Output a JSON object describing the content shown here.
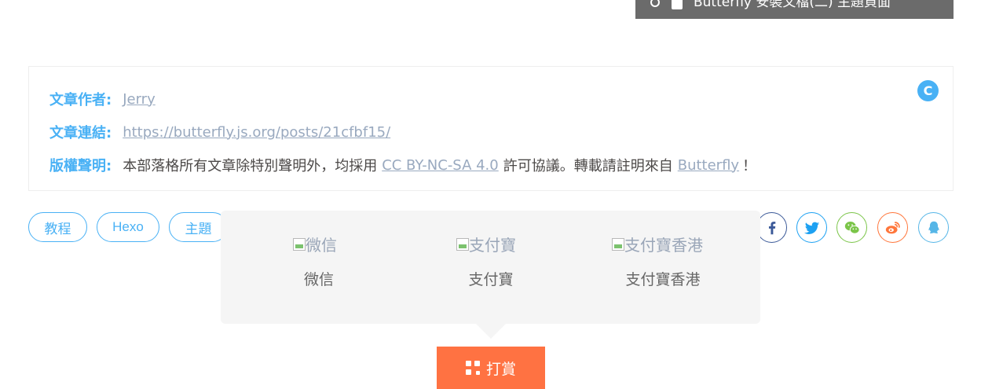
{
  "top_bar": {
    "title": "Butterfly 安裝文檔(二) 主題頁面"
  },
  "copyright": {
    "author_key": "文章作者:",
    "author_value": "Jerry",
    "link_key": "文章連結:",
    "link_value": "https://butterfly.js.org/posts/21cfbf15/",
    "license_key": "版權聲明:",
    "license_text_1": "本部落格所有文章除特別聲明外，均採用",
    "license_link": "CC BY-NC-SA 4.0",
    "license_text_2": "許可協議。轉載請註明來自",
    "license_site": "Butterfly",
    "license_text_3": "！",
    "badge": "C"
  },
  "tags": [
    "教程",
    "Hexo",
    "主題"
  ],
  "share": [
    {
      "name": "facebook-icon",
      "color": "#3b5998"
    },
    {
      "name": "twitter-icon",
      "color": "#1da1f2"
    },
    {
      "name": "wechat-icon",
      "color": "#7bc549"
    },
    {
      "name": "weibo-icon",
      "color": "#ff763b"
    },
    {
      "name": "qq-icon",
      "color": "#56b6e7"
    }
  ],
  "reward": {
    "items": [
      {
        "alt": "微信",
        "label": "微信"
      },
      {
        "alt": "支付寶",
        "label": "支付寶"
      },
      {
        "alt": "支付寶香港",
        "label": "支付寶香港"
      }
    ],
    "button_label": "打賞"
  }
}
